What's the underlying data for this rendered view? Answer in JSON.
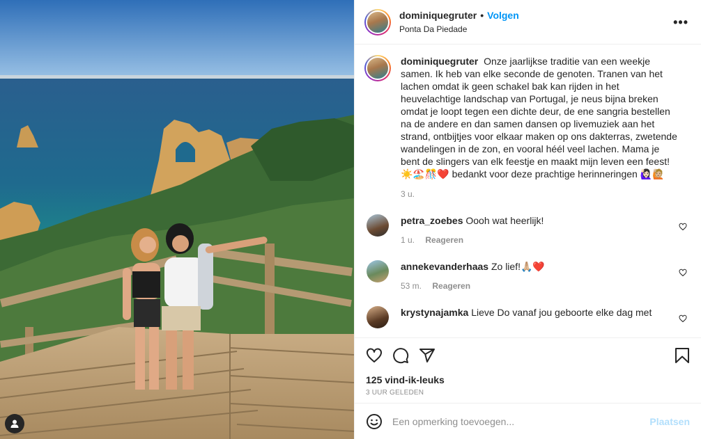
{
  "post": {
    "username": "dominiquegruter",
    "dot": "•",
    "follow_label": "Volgen",
    "location": "Ponta Da Piedade",
    "more_label": "•••"
  },
  "caption": {
    "username": "dominiquegruter",
    "text": "Onze jaarlijkse traditie van een weekje samen. Ik heb van elke seconde de genoten. Tranen van het lachen omdat ik geen schakel bak kan rijden in het heuvelachtige landschap van Portugal, je neus bijna breken omdat je loopt tegen een dichte deur, de ene sangria bestellen na de andere en dan samen dansen op livemuziek aan het strand, ontbijtjes voor elkaar maken op ons dakterras, zwetende wandelingen in de zon, en vooral héél veel lachen. Mama je bent de slingers van elk feestje en maakt mijn leven een feest! ☀️🏖️🎊❤️ bedankt voor deze prachtige herinneringen 🙋🏻‍♀️🙋🏼",
    "time": "3 u."
  },
  "comments": [
    {
      "username": "petra_zoebes",
      "text": "Oooh wat heerlijk!",
      "time": "1 u.",
      "reply_label": "Reageren"
    },
    {
      "username": "annekevanderhaas",
      "text": "Zo lief!🙏🏼❤️",
      "time": "53 m.",
      "reply_label": "Reageren"
    },
    {
      "username": "krystynajamka",
      "text": "Lieve Do vanaf jou geboorte elke dag met",
      "time": "",
      "reply_label": ""
    }
  ],
  "engagement": {
    "likes": "125 vind-ik-leuks",
    "time_ago": "3 UUR GELEDEN"
  },
  "composer": {
    "placeholder": "Een opmerking toevoegen...",
    "post_label": "Plaatsen"
  },
  "icons": {
    "like": "heart-icon",
    "comment": "comment-icon",
    "share": "share-icon",
    "save": "bookmark-icon",
    "emoji": "emoji-icon",
    "more": "more-icon",
    "tag": "user-tag-icon"
  },
  "colors": {
    "accent": "#0095f6",
    "post_disabled": "#b2dffc",
    "muted": "#8e8e8e",
    "text": "#262626"
  }
}
